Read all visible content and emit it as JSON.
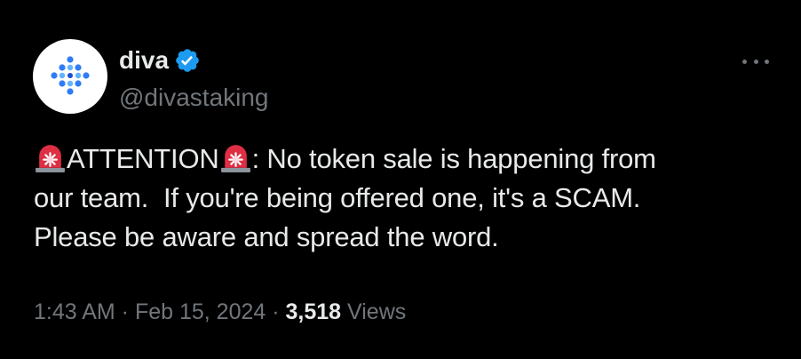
{
  "author": {
    "display_name": "diva",
    "handle": "@divastaking",
    "verified": true,
    "avatar_icon": "diva-logo-icon"
  },
  "more_icon": "more-options-icon",
  "tweet": {
    "word_attention": "ATTENTION",
    "after_attention": ": No token sale is happening from",
    "line2": "our team.  If you're being offered one, it's a SCAM.",
    "line3": "Please be aware and spread the word.",
    "emoji": "police-car-light-emoji"
  },
  "meta": {
    "time": "1:43 AM",
    "sep1": " · ",
    "date": "Feb 15, 2024",
    "sep2": " · ",
    "views_count": "3,518",
    "views_label": " Views"
  },
  "colors": {
    "background": "#000000",
    "primary_text": "#e7e9ea",
    "secondary_text": "#71767b",
    "verified_blue": "#1d9bf0",
    "brand_blue": "#2f7cf6"
  }
}
